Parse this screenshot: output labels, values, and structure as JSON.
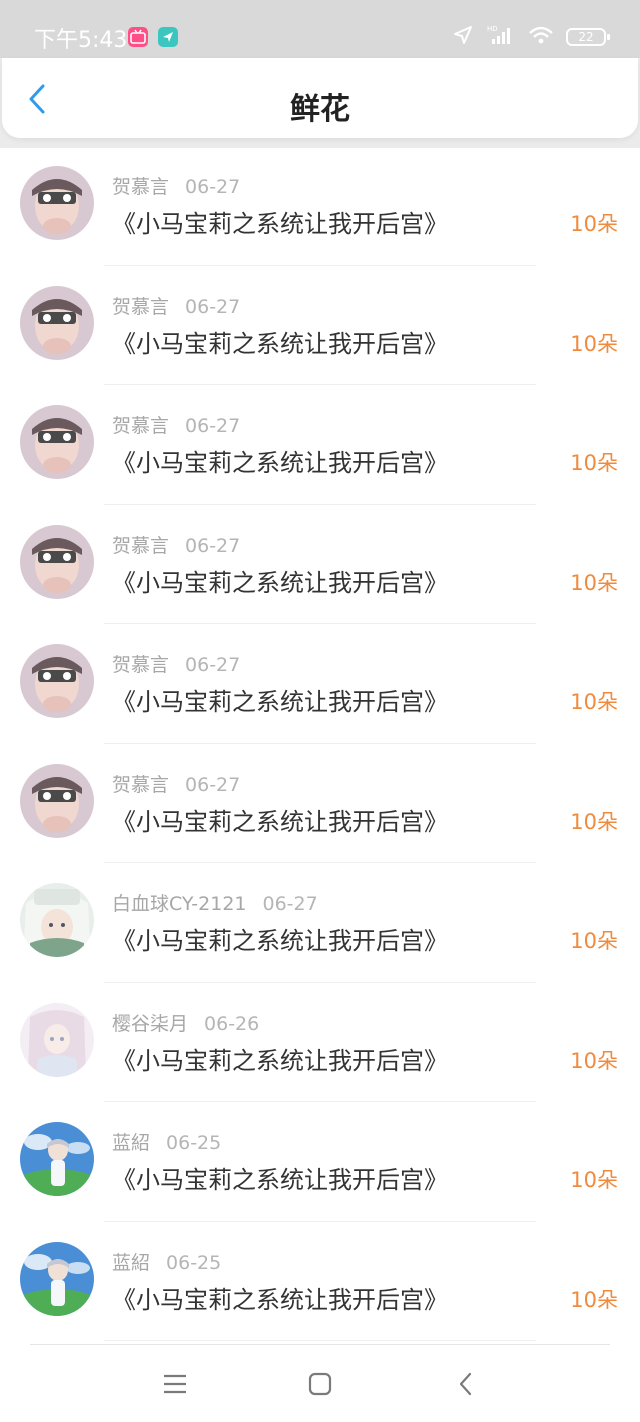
{
  "status_bar": {
    "time": "下午5:43",
    "app_badge_1": "bili",
    "app_badge_2": "➤",
    "battery": "22",
    "signal_label": "HD"
  },
  "header": {
    "title": "鲜花",
    "back_icon": "chevron-left-icon"
  },
  "list": [
    {
      "user": "贺慕言",
      "date": "06-27",
      "book": "《小马宝莉之系统让我开后宫》",
      "count": "10朵",
      "avatar": "baby-photo"
    },
    {
      "user": "贺慕言",
      "date": "06-27",
      "book": "《小马宝莉之系统让我开后宫》",
      "count": "10朵",
      "avatar": "baby-photo"
    },
    {
      "user": "贺慕言",
      "date": "06-27",
      "book": "《小马宝莉之系统让我开后宫》",
      "count": "10朵",
      "avatar": "baby-photo"
    },
    {
      "user": "贺慕言",
      "date": "06-27",
      "book": "《小马宝莉之系统让我开后宫》",
      "count": "10朵",
      "avatar": "baby-photo"
    },
    {
      "user": "贺慕言",
      "date": "06-27",
      "book": "《小马宝莉之系统让我开后宫》",
      "count": "10朵",
      "avatar": "baby-photo"
    },
    {
      "user": "贺慕言",
      "date": "06-27",
      "book": "《小马宝莉之系统让我开后宫》",
      "count": "10朵",
      "avatar": "baby-photo"
    },
    {
      "user": "白血球CY-2121",
      "date": "06-27",
      "book": "《小马宝莉之系统让我开后宫》",
      "count": "10朵",
      "avatar": "anime-white-hair"
    },
    {
      "user": "樱谷柒月",
      "date": "06-26",
      "book": "《小马宝莉之系统让我开后宫》",
      "count": "10朵",
      "avatar": "anime-pastel"
    },
    {
      "user": "蓝紹",
      "date": "06-25",
      "book": "《小马宝莉之系统让我开后宫》",
      "count": "10朵",
      "avatar": "anime-sky"
    },
    {
      "user": "蓝紹",
      "date": "06-25",
      "book": "《小马宝莉之系统让我开后宫》",
      "count": "10朵",
      "avatar": "anime-sky"
    }
  ],
  "nav_bar": {
    "menu_icon": "menu-icon",
    "home_icon": "home-square-icon",
    "back_icon": "back-chevron-icon"
  },
  "colors": {
    "accent": "#2f9bef",
    "count": "#f08a3c",
    "status_bar_bg": "#d9d9d9"
  }
}
